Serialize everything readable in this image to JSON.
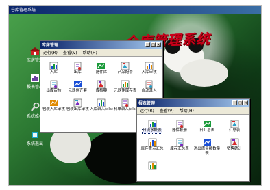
{
  "app": {
    "title": "仓库管理系统",
    "banner": "仓库管理系统"
  },
  "desktop": [
    {
      "label": "库房管理",
      "icon": "warehouse-icon",
      "color": "#cc2222"
    },
    {
      "label": "报表管理",
      "icon": "report-icon",
      "color": "#6b3fa0"
    },
    {
      "label": "系统维护",
      "icon": "wrench-icon",
      "color": "#dddddd"
    },
    {
      "label": "系统退出",
      "icon": "exit-icon",
      "color": "#1aa7c9"
    }
  ],
  "win1": {
    "title": "库房管理",
    "menu": [
      "运行(R)",
      "查看(V)",
      "帮助(H)"
    ],
    "items": [
      {
        "label": "入库",
        "icon": "inbound-icon"
      },
      {
        "label": "出库",
        "icon": "outbound-icon"
      },
      {
        "label": "器件库",
        "icon": "parts-library-icon"
      },
      {
        "label": "产品配套",
        "icon": "product-kit-icon"
      },
      {
        "label": "入库审核",
        "icon": "inbound-audit-icon"
      },
      {
        "label": "出库审核",
        "icon": "outbound-audit-icon"
      },
      {
        "label": "元器件齐套",
        "icon": "component-kit-icon"
      },
      {
        "label": "库档案",
        "icon": "archive-icon"
      },
      {
        "label": "元器件库存表",
        "icon": "stock-table-icon"
      },
      {
        "label": "自动录入",
        "icon": "auto-entry-icon"
      },
      {
        "label": "包装入库审核",
        "icon": "package-audit-icon"
      },
      {
        "label": "包装出库审核",
        "icon": "package-out-audit-icon"
      },
      {
        "label": "入库录入(xls)",
        "icon": "import-in-xls-icon"
      },
      {
        "label": "料单录入(xls)",
        "icon": "import-bom-xls-icon"
      }
    ]
  },
  "win2": {
    "title": "报表管理",
    "menu": [
      "运行(R)",
      "查看(V)",
      "帮助(H)"
    ],
    "items": [
      {
        "label": "日流水帐表",
        "icon": "daily-ledger-icon",
        "selected": true
      },
      {
        "label": "器件帐册",
        "icon": "parts-ledger-icon"
      },
      {
        "label": "日汇总表",
        "icon": "daily-summary-icon"
      },
      {
        "label": "汇总表",
        "icon": "summary-icon"
      },
      {
        "label": "库存盘点汇总",
        "icon": "inventory-check-icon"
      },
      {
        "label": "库存汇总表",
        "icon": "stock-summary-icon"
      },
      {
        "label": "进出库金额数量表",
        "icon": "amount-qty-icon"
      },
      {
        "label": "销售统计",
        "icon": "sales-stats-icon"
      },
      {
        "label": "",
        "icon": "chart-icon"
      }
    ]
  },
  "colors": {
    "accent": "#c8001a",
    "titlebar": "#0a246a",
    "bg": "#2d7a33"
  }
}
